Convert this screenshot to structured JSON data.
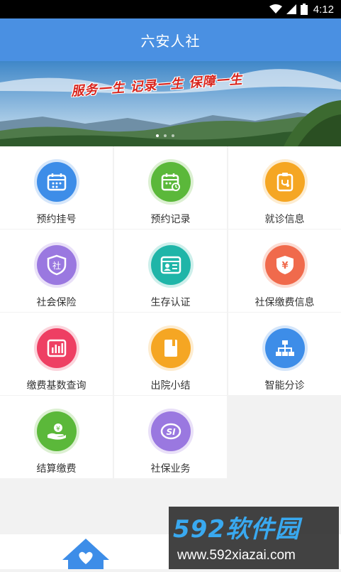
{
  "status_bar": {
    "time": "4:12"
  },
  "header": {
    "title": "六安人社"
  },
  "banner": {
    "slogan": "服务一生 记录一生 保障一生"
  },
  "tiles": [
    {
      "label": "预约挂号",
      "icon": "calendar-icon",
      "color": "#3d8de8"
    },
    {
      "label": "预约记录",
      "icon": "calendar-check-icon",
      "color": "#5bb83a"
    },
    {
      "label": "就诊信息",
      "icon": "stethoscope-icon",
      "color": "#f5a623"
    },
    {
      "label": "社会保险",
      "icon": "insurance-shield-icon",
      "color": "#9a78e0"
    },
    {
      "label": "生存认证",
      "icon": "id-card-icon",
      "color": "#1fb5a8"
    },
    {
      "label": "社保缴费信息",
      "icon": "yuan-shield-icon",
      "color": "#f06a4c"
    },
    {
      "label": "缴费基数查询",
      "icon": "bar-chart-icon",
      "color": "#ee3f63"
    },
    {
      "label": "出院小结",
      "icon": "book-icon",
      "color": "#f5a623"
    },
    {
      "label": "智能分诊",
      "icon": "org-chart-icon",
      "color": "#3d8de8"
    },
    {
      "label": "结算缴费",
      "icon": "hand-coin-icon",
      "color": "#5bb83a"
    },
    {
      "label": "社保业务",
      "icon": "si-logo-icon",
      "color": "#9a78e0"
    }
  ],
  "watermark": {
    "brand": "592软件园",
    "url": "www.592xiazai.com"
  }
}
